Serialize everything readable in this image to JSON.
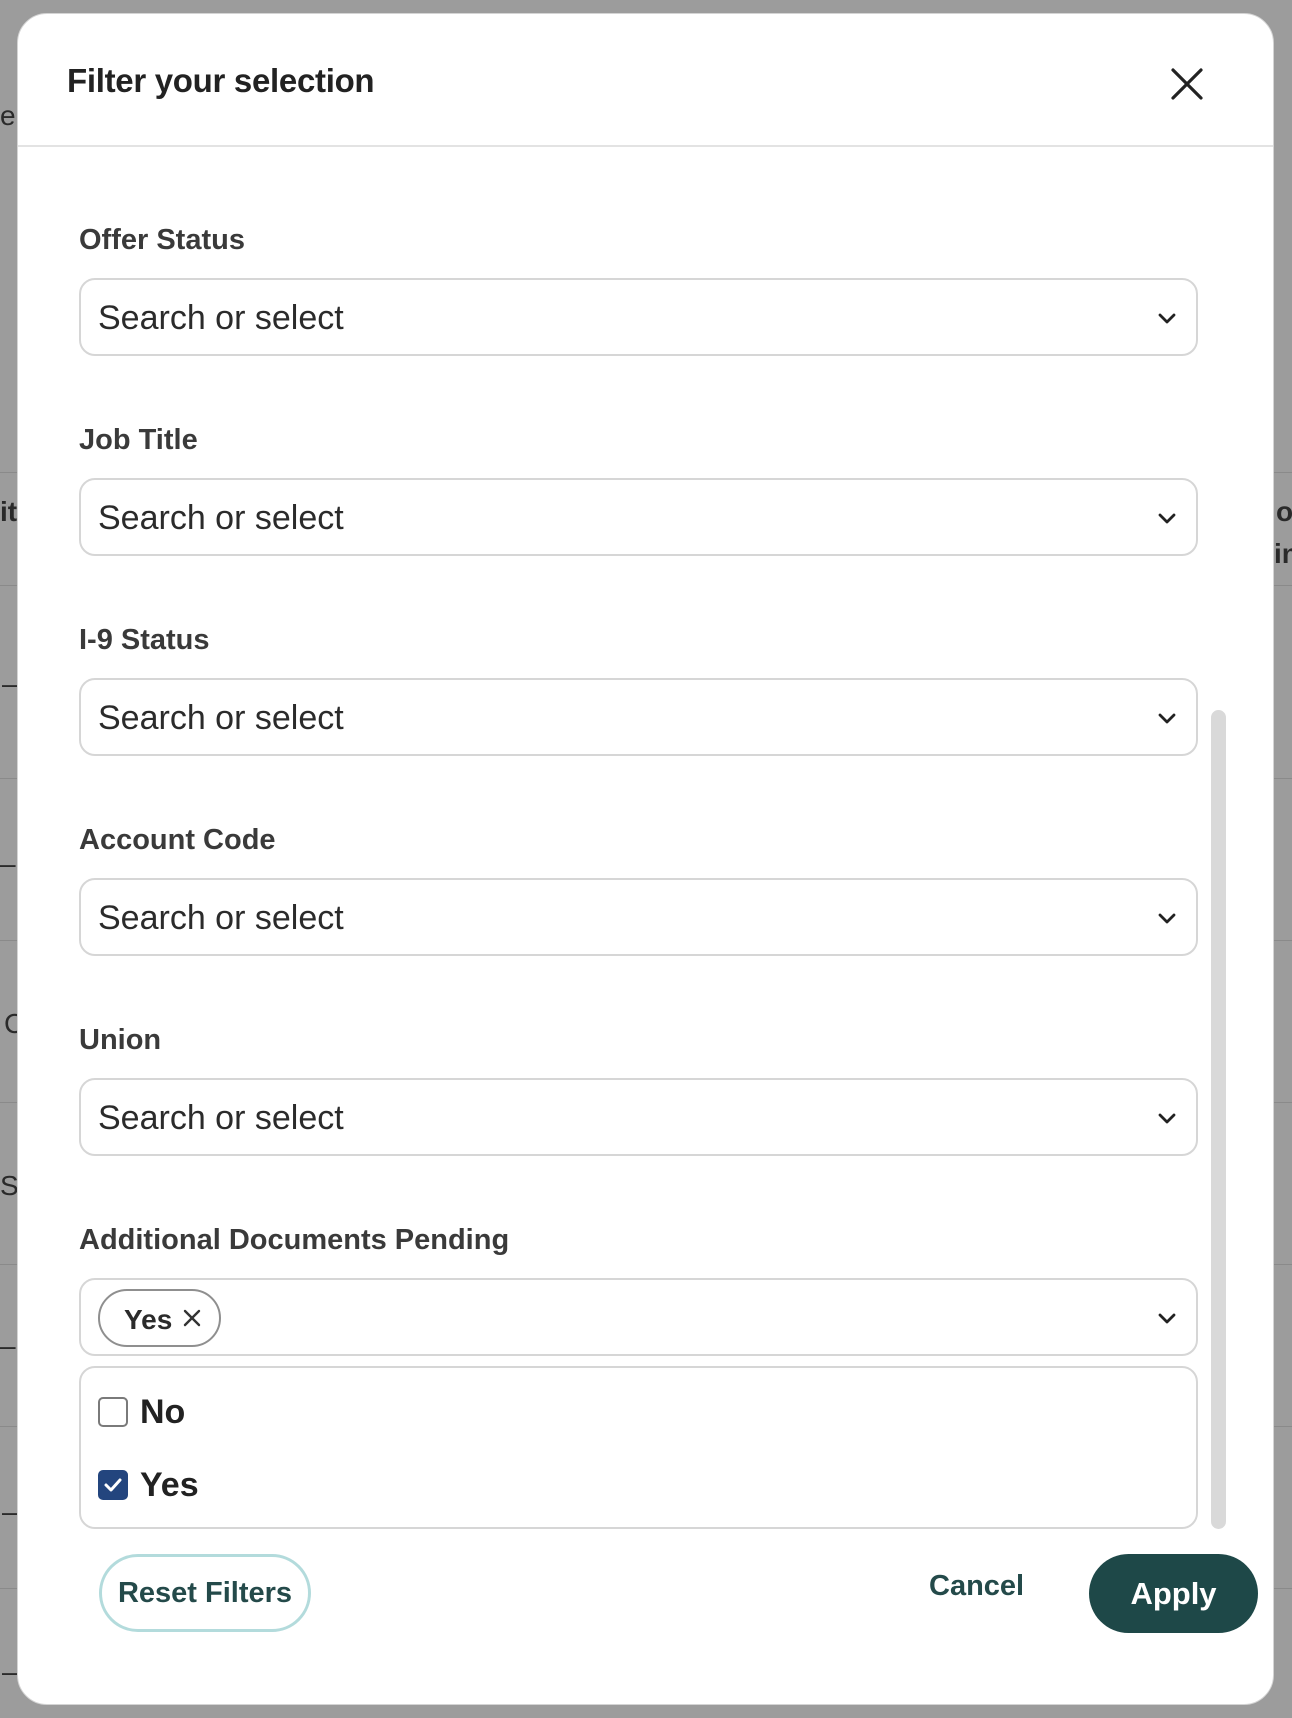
{
  "background": {
    "fragments": [
      "er",
      "it",
      "o",
      "in",
      "–",
      "–",
      "C",
      "S",
      "–",
      "–",
      "–"
    ]
  },
  "modal": {
    "title": "Filter your selection",
    "close_icon": "close-icon"
  },
  "filters": [
    {
      "label": "Offer Status",
      "placeholder": "Search or select"
    },
    {
      "label": "Job Title",
      "placeholder": "Search or select"
    },
    {
      "label": "I-9 Status",
      "placeholder": "Search or select"
    },
    {
      "label": "Account Code",
      "placeholder": "Search or select"
    },
    {
      "label": "Union",
      "placeholder": "Search or select"
    },
    {
      "label": "Additional Documents Pending",
      "selected_chips": [
        "Yes"
      ],
      "options": [
        {
          "label": "No",
          "checked": false
        },
        {
          "label": "Yes",
          "checked": true
        }
      ]
    }
  ],
  "footer": {
    "reset_label": "Reset Filters",
    "cancel_label": "Cancel",
    "apply_label": "Apply"
  },
  "colors": {
    "overlay": "#9c9c9c",
    "primary": "#1e4848",
    "reset_border": "#b3dbdc",
    "checkbox_checked": "#23457e"
  }
}
